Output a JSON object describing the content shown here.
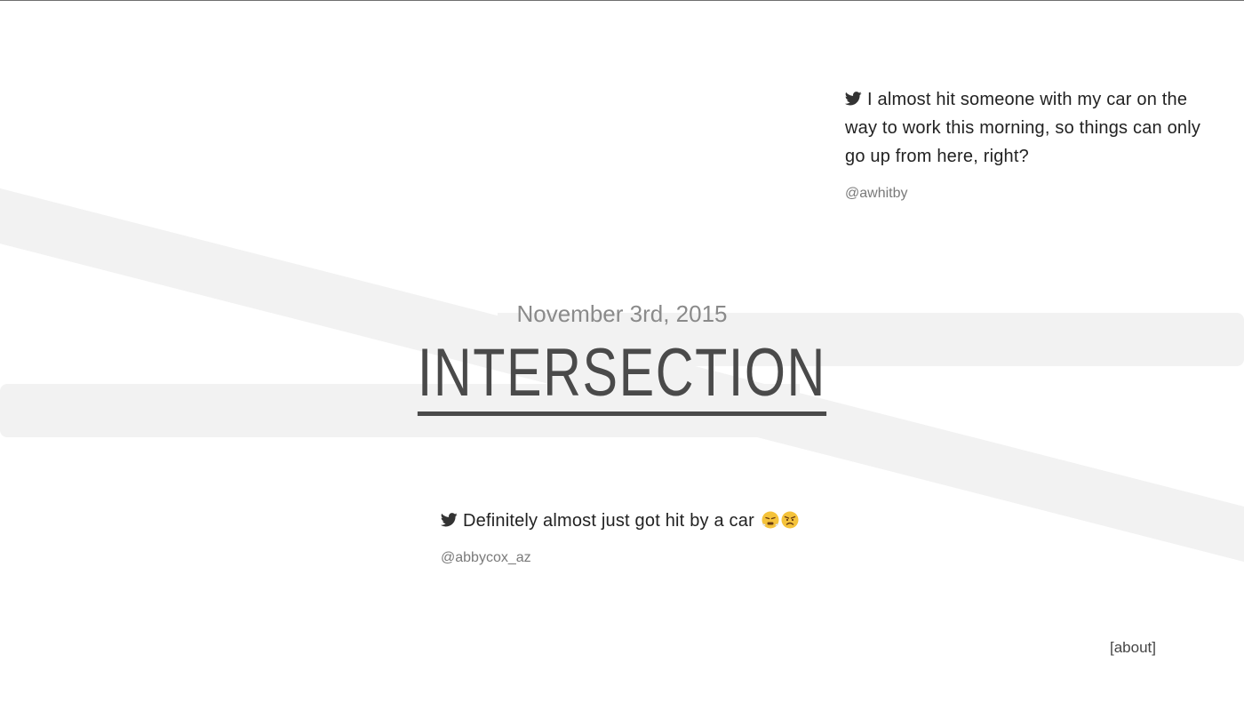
{
  "page": {
    "date": "November 3rd, 2015",
    "title": "INTERSECTION",
    "about_label": "[about]"
  },
  "tweets": [
    {
      "text": "I almost hit someone with my car on the way to work this morning, so things can only go up from here, right?",
      "handle": "@awhitby",
      "icon": "twitter-bird-icon"
    },
    {
      "text": "Definitely almost just got hit by a car",
      "handle": "@abbycox_az",
      "icon": "twitter-bird-icon",
      "emojis": [
        "face-with-steam-from-nose-emoji",
        "angry-face-emoji"
      ]
    }
  ],
  "colors": {
    "road": "#f2f2f2",
    "title": "#4a4a4a",
    "date": "#8a8a8a",
    "handle": "#7a7a7a",
    "text": "#222222"
  }
}
